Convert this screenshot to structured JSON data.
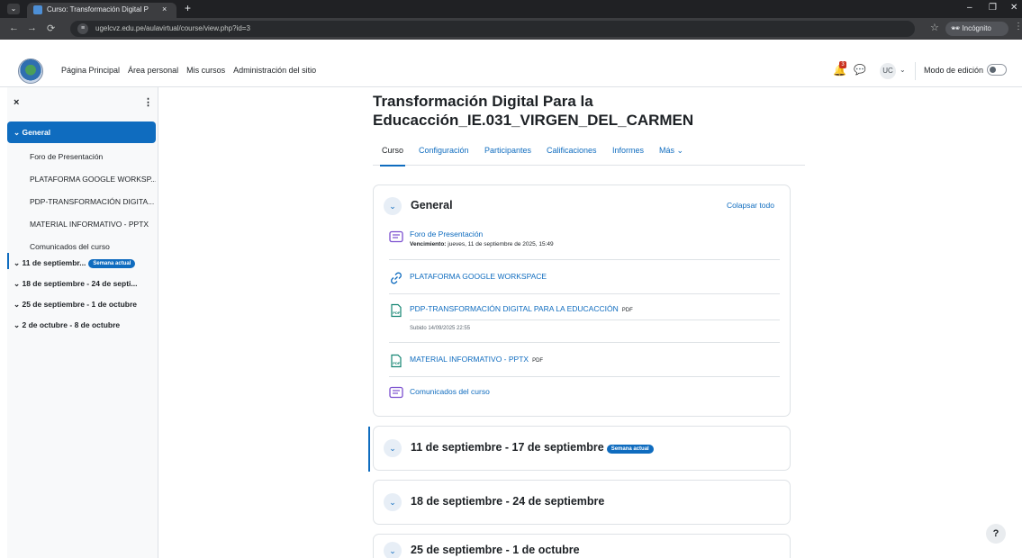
{
  "browser": {
    "tab_title": "Curso: Transformación Digital P",
    "tab_close": "×",
    "new_tab": "+",
    "url": "ugelcvz.edu.pe/aulavirtual/course/view.php?id=3",
    "incognito_label": "Incógnito",
    "menu_glyph": "⌄",
    "back_glyph": "←",
    "forward_glyph": "→",
    "reload_glyph": "⟳",
    "site_info_glyph": "≡",
    "star_glyph": "☆",
    "kebab_glyph": "⋮",
    "minimize_glyph": "–",
    "maximize_glyph": "❐",
    "close_glyph": "✕"
  },
  "navbar": {
    "items": [
      "Página Principal",
      "Área personal",
      "Mis cursos",
      "Administración del sitio"
    ],
    "notification_count": "3",
    "user_initials": "UC",
    "caret_glyph": "⌄",
    "bell_glyph": "🔔",
    "chat_glyph": "💬",
    "edit_mode_label": "Modo de edición"
  },
  "course_index": {
    "close_glyph": "×",
    "kebab_glyph": "⋮",
    "general_label": "⌄ General",
    "items": [
      "Foro de Presentación",
      "PLATAFORMA GOOGLE WORKSP...",
      "PDP-TRANSFORMACIÓN DIGITA...",
      "MATERIAL INFORMATIVO - PPTX",
      "Comunicados del curso"
    ],
    "sections": [
      "⌄ 11 de septiembr...",
      "⌄ 18 de septiembre - 24 de septi...",
      "⌄ 25 de septiembre - 1 de octubre",
      "⌄ 2 de octubre - 8 de octubre"
    ],
    "current_badge": "Semana actual"
  },
  "page": {
    "title": "Transformación Digital Para la Educacción_IE.031_VIRGEN_DEL_CARMEN",
    "tabs": [
      "Curso",
      "Configuración",
      "Participantes",
      "Calificaciones",
      "Informes",
      "Más ⌄"
    ]
  },
  "general_section": {
    "chevron_glyph": "⌄",
    "title": "General",
    "collapse_all": "Colapsar todo",
    "activities": [
      {
        "name": "Foro de Presentación",
        "meta_label": "Vencimiento:",
        "meta_value": " jueves, 11 de septiembre de 2025, 15:49",
        "icon": "forum-icon"
      },
      {
        "name": "PLATAFORMA GOOGLE WORKSPACE",
        "icon": "url-link-icon"
      },
      {
        "name": "PDP-TRANSFORMACIÓN DIGITAL PARA LA EDUCACCIÓN",
        "type": "PDF",
        "uploaded": "Subido 14/09/2025 22:55",
        "icon": "pdf-file-icon"
      },
      {
        "name": "MATERIAL INFORMATIVO - PPTX",
        "type": "PDF",
        "icon": "pdf-file-icon"
      },
      {
        "name": "Comunicados del curso",
        "icon": "forum-icon"
      }
    ]
  },
  "weeks": [
    {
      "title": "11 de septiembre - 17 de septiembre",
      "badge": "Semana actual"
    },
    {
      "title": "18 de septiembre - 24 de septiembre"
    },
    {
      "title": "25 de septiembre - 1 de octubre"
    }
  ],
  "help": "?",
  "colors": {
    "brand_blue": "#0f6cbf",
    "chrome_dark": "#202124",
    "chrome_toolbar": "#3c3d40",
    "drawer_bg": "#f8f9fa",
    "notification_red": "#ca3120"
  }
}
